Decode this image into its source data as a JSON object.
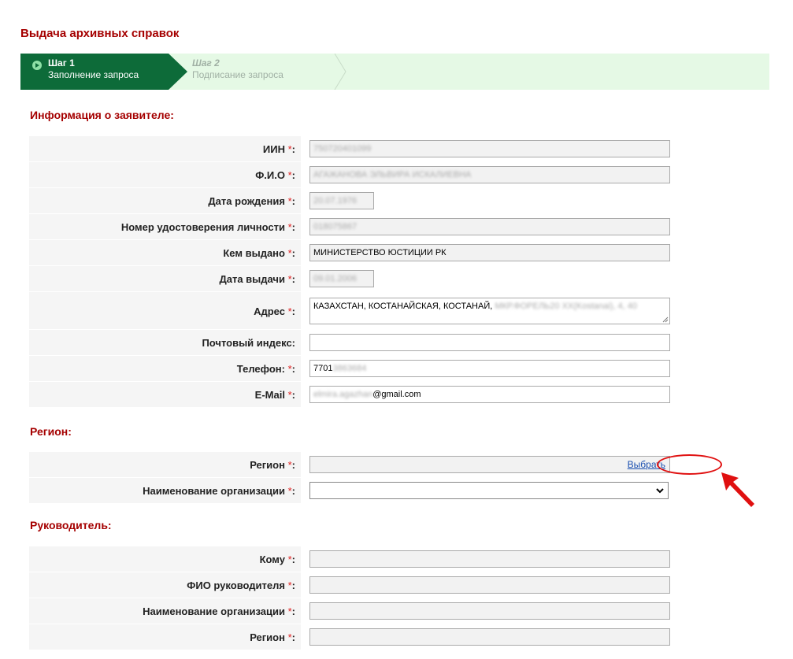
{
  "page": {
    "title": "Выдача архивных справок"
  },
  "steps": [
    {
      "number": "Шаг 1",
      "label": "Заполнение запроса"
    },
    {
      "number": "Шаг 2",
      "label": "Подписание запроса"
    }
  ],
  "required_mark": "*",
  "applicant": {
    "section_title": "Информация о заявителе:",
    "iin": {
      "label": "ИИН",
      "value": "750720401099"
    },
    "fio": {
      "label": "Ф.И.О",
      "value": "АГАЖАНОВА ЭЛЬВИРА ИСКАЛИЕВНА"
    },
    "birth_date": {
      "label": "Дата рождения",
      "value": "20.07.1976"
    },
    "id_number": {
      "label": "Номер удостоверения личности",
      "value": "018075867"
    },
    "issued_by": {
      "label": "Кем выдано",
      "value": "МИНИСТЕРСТВО ЮСТИЦИИ РК"
    },
    "issue_date": {
      "label": "Дата выдачи",
      "value": "09.01.2006"
    },
    "address": {
      "label": "Адрес",
      "value": "КАЗАХСТАН, КОСТАНАЙСКАЯ, КОСТАНАЙ,",
      "value_hidden": "МКР.ФОРЕЛЬ20 ХХ(Kostanai), 4, 40"
    },
    "postal_code": {
      "label": "Почтовый индекс:",
      "value": ""
    },
    "phone": {
      "label": "Телефон:",
      "value": "7701",
      "value_hidden": "3863684"
    },
    "email": {
      "label": "E-Mail",
      "value_hidden": "elmira.agazhan",
      "value": "@gmail.com"
    }
  },
  "region": {
    "section_title": "Регион:",
    "region_field": {
      "label": "Регион",
      "value": "",
      "action_link": "Выбрать"
    },
    "organization": {
      "label": "Наименование организации",
      "value": ""
    }
  },
  "manager": {
    "section_title": "Руководитель:",
    "to_whom": {
      "label": "Кому",
      "value": ""
    },
    "manager_fio": {
      "label": "ФИО руководителя",
      "value": ""
    },
    "org_name": {
      "label": "Наименование организации",
      "value": ""
    },
    "region": {
      "label": "Регион",
      "value": ""
    }
  },
  "colors": {
    "accent": "#a50000",
    "step_active": "#0d6b39",
    "step_bar": "#e5f9e5",
    "required": "#e02020",
    "annotation": "#e01010"
  }
}
